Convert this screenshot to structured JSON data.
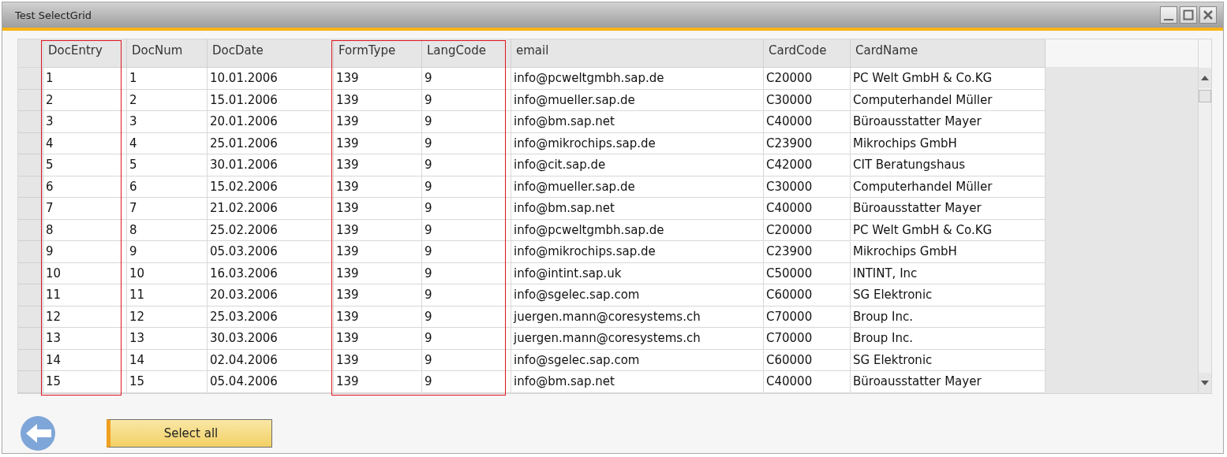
{
  "window": {
    "title": "Test SelectGrid"
  },
  "table": {
    "columns": [
      {
        "label": "DocEntry",
        "highlighted": true
      },
      {
        "label": "DocNum",
        "highlighted": false
      },
      {
        "label": "DocDate",
        "highlighted": false
      },
      {
        "label": "FormType",
        "highlighted": true
      },
      {
        "label": "LangCode",
        "highlighted": true
      },
      {
        "label": "email",
        "highlighted": false
      },
      {
        "label": "CardCode",
        "highlighted": false
      },
      {
        "label": "CardName",
        "highlighted": false
      }
    ],
    "rows": [
      [
        "1",
        "1",
        "10.01.2006",
        "139",
        "9",
        "info@pcweltgmbh.sap.de",
        "C20000",
        "PC Welt GmbH & Co.KG"
      ],
      [
        "2",
        "2",
        "15.01.2006",
        "139",
        "9",
        "info@mueller.sap.de",
        "C30000",
        "Computerhandel Müller"
      ],
      [
        "3",
        "3",
        "20.01.2006",
        "139",
        "9",
        "info@bm.sap.net",
        "C40000",
        "Büroausstatter Mayer"
      ],
      [
        "4",
        "4",
        "25.01.2006",
        "139",
        "9",
        "info@mikrochips.sap.de",
        "C23900",
        "Mikrochips GmbH"
      ],
      [
        "5",
        "5",
        "30.01.2006",
        "139",
        "9",
        "info@cit.sap.de",
        "C42000",
        "CIT Beratungshaus"
      ],
      [
        "6",
        "6",
        "15.02.2006",
        "139",
        "9",
        "info@mueller.sap.de",
        "C30000",
        "Computerhandel Müller"
      ],
      [
        "7",
        "7",
        "21.02.2006",
        "139",
        "9",
        "info@bm.sap.net",
        "C40000",
        "Büroausstatter Mayer"
      ],
      [
        "8",
        "8",
        "25.02.2006",
        "139",
        "9",
        "info@pcweltgmbh.sap.de",
        "C20000",
        "PC Welt GmbH & Co.KG"
      ],
      [
        "9",
        "9",
        "05.03.2006",
        "139",
        "9",
        "info@mikrochips.sap.de",
        "C23900",
        "Mikrochips GmbH"
      ],
      [
        "10",
        "10",
        "16.03.2006",
        "139",
        "9",
        "info@intint.sap.uk",
        "C50000",
        "INTINT, Inc"
      ],
      [
        "11",
        "11",
        "20.03.2006",
        "139",
        "9",
        "info@sgelec.sap.com",
        "C60000",
        "SG Elektronic"
      ],
      [
        "12",
        "12",
        "25.03.2006",
        "139",
        "9",
        "juergen.mann@coresystems.ch",
        "C70000",
        "Broup Inc."
      ],
      [
        "13",
        "13",
        "30.03.2006",
        "139",
        "9",
        "juergen.mann@coresystems.ch",
        "C70000",
        "Broup Inc."
      ],
      [
        "14",
        "14",
        "02.04.2006",
        "139",
        "9",
        "info@sgelec.sap.com",
        "C60000",
        "SG Elektronic"
      ],
      [
        "15",
        "15",
        "05.04.2006",
        "139",
        "9",
        "info@bm.sap.net",
        "C40000",
        "Büroausstatter Mayer"
      ]
    ]
  },
  "buttons": [
    {
      "label": "Select all"
    }
  ]
}
